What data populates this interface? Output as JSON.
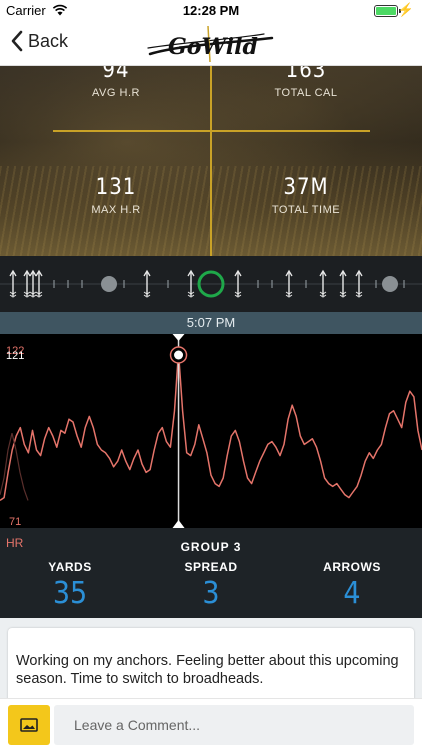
{
  "status_bar": {
    "carrier": "Carrier",
    "time": "12:28 PM"
  },
  "nav": {
    "back_label": "Back",
    "logo_text": "GoWild"
  },
  "stats": {
    "avg_hr": {
      "value": "94",
      "label": "AVG H.R"
    },
    "total_cal": {
      "value": "163",
      "label": "TOTAL CAL"
    },
    "max_hr": {
      "value": "131",
      "label": "MAX H.R"
    },
    "total_time": {
      "value": "37M",
      "label": "TOTAL TIME"
    }
  },
  "timeline": {
    "time": "5:07 PM"
  },
  "chart_data": {
    "type": "line",
    "series": [
      {
        "values": [
          78,
          79,
          88,
          96,
          101,
          104,
          98,
          95,
          103,
          96,
          94,
          100,
          104,
          101,
          97,
          103,
          102,
          107,
          106,
          101,
          97,
          104,
          108,
          104,
          98,
          96,
          95,
          93,
          90,
          92,
          96,
          92,
          89,
          93,
          96,
          91,
          88,
          89,
          96,
          102,
          104,
          99,
          97,
          110,
          131,
          110,
          95,
          94,
          98,
          105,
          100,
          95,
          87,
          84,
          83,
          86,
          94,
          101,
          103,
          99,
          92,
          86,
          84,
          88,
          92,
          95,
          98,
          99,
          97,
          94,
          98,
          107,
          112,
          108,
          101,
          98,
          99,
          100,
          97,
          92,
          86,
          84,
          83,
          84,
          82,
          80,
          79,
          81,
          83,
          87,
          92,
          95,
          93,
          96,
          98,
          104,
          109,
          110,
          107,
          104,
          113,
          117,
          115,
          103,
          96
        ]
      }
    ],
    "y_top_label": "122",
    "y_bottom_label": "71",
    "ylim": [
      71,
      131
    ],
    "marker_label": "121",
    "marker_index": 44
  },
  "group": {
    "hr_label": "HR",
    "title": "GROUP  3",
    "yards_label": "YARDS",
    "yards_value": "35",
    "spread_label": "SPREAD",
    "spread_value": "3",
    "arrows_label": "ARROWS",
    "arrows_value": "4"
  },
  "comment": {
    "text": "Working on my anchors. Feeling better about this upcoming season. Time to switch to broadheads."
  },
  "input": {
    "placeholder": "Leave a Comment..."
  },
  "colors": {
    "accent_gold": "#c9a227",
    "chart_line": "#e5746a",
    "metric_blue": "#2b8fd6",
    "selected_ring": "#1fa84a",
    "image_button": "#f3c71b"
  }
}
